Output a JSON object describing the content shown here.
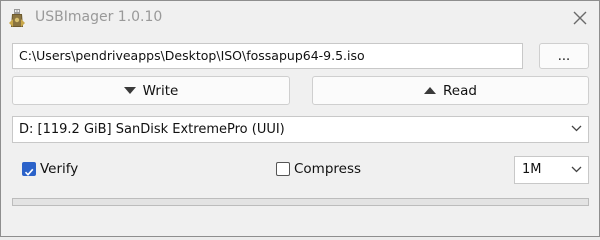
{
  "window": {
    "title": "USBImager 1.0.10",
    "app_icon": "usbimager-icon",
    "close_icon": "close-icon"
  },
  "source": {
    "path": "C:\\Users\\pendriveapps\\Desktop\\ISO\\fossapup64-9.5.iso",
    "browse_label": "..."
  },
  "actions": {
    "write_label": "Write",
    "write_icon": "down-arrow-icon",
    "read_label": "Read",
    "read_icon": "up-arrow-icon"
  },
  "device": {
    "selected": "D: [119.2 GiB] SanDisk ExtremePro (UUI)"
  },
  "options": {
    "verify_label": "Verify",
    "verify_checked": true,
    "compress_label": "Compress",
    "compress_checked": false,
    "buffer_size": "1M"
  },
  "progress": {
    "fraction": 0
  },
  "colors": {
    "checkbox_accent": "#2b62c9",
    "window_bg": "#f0f0f0",
    "title_text": "#999999"
  }
}
